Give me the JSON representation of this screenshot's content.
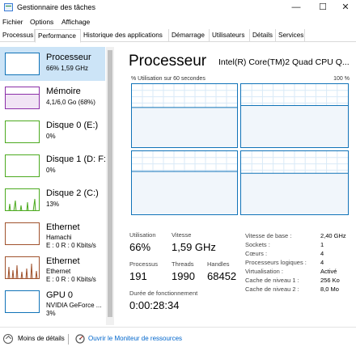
{
  "window": {
    "title": "Gestionnaire des tâches",
    "minimize_glyph": "—",
    "maximize_glyph": "☐",
    "close_glyph": "✕"
  },
  "menu": [
    "Fichier",
    "Options",
    "Affichage"
  ],
  "tabs": [
    {
      "label": "Processus",
      "active": false
    },
    {
      "label": "Performance",
      "active": true
    },
    {
      "label": "Historique des applications",
      "active": false
    },
    {
      "label": "Démarrage",
      "active": false
    },
    {
      "label": "Utilisateurs",
      "active": false
    },
    {
      "label": "Détails",
      "active": false
    },
    {
      "label": "Services",
      "active": false
    }
  ],
  "sidebar": [
    {
      "name": "Processeur",
      "lines": [
        "66% 1,59 GHz"
      ],
      "color": "#1173b8",
      "selected": true,
      "icon": "cpu-thumbnail-icon"
    },
    {
      "name": "Mémoire",
      "lines": [
        "4,1/6,0 Go (68%)"
      ],
      "color": "#8b2fa8",
      "selected": false,
      "icon": "memory-thumbnail-icon",
      "fill": 0.68
    },
    {
      "name": "Disque 0 (E:)",
      "lines": [
        "0%"
      ],
      "color": "#4caa1f",
      "selected": false,
      "icon": "disk-thumbnail-icon"
    },
    {
      "name": "Disque 1 (D: F:)",
      "lines": [
        "0%"
      ],
      "color": "#4caa1f",
      "selected": false,
      "icon": "disk-thumbnail-icon"
    },
    {
      "name": "Disque 2 (C:)",
      "lines": [
        "13%"
      ],
      "color": "#4caa1f",
      "selected": false,
      "icon": "disk-thumbnail-icon"
    },
    {
      "name": "Ethernet",
      "lines": [
        "Hamachi",
        "E : 0 R : 0 Kbits/s"
      ],
      "color": "#a0522d",
      "selected": false,
      "icon": "network-thumbnail-icon"
    },
    {
      "name": "Ethernet",
      "lines": [
        "Ethernet",
        "E : 0 R : 0 Kbits/s"
      ],
      "color": "#a0522d",
      "selected": false,
      "icon": "network-thumbnail-icon"
    },
    {
      "name": "GPU 0",
      "lines": [
        "NVIDIA GeForce ...",
        "3%"
      ],
      "color": "#1173b8",
      "selected": false,
      "icon": "gpu-thumbnail-icon"
    }
  ],
  "main": {
    "title": "Processeur",
    "cpu_model": "Intel(R) Core(TM)2 Quad CPU Q...",
    "graph_caption": "% Utilisation sur 60 secondes",
    "graph_max": "100 %",
    "graph_color": "#1173b8",
    "cores_usage_percent": [
      63,
      66,
      68,
      65
    ]
  },
  "stats": {
    "utilisation_label": "Utilisation",
    "utilisation_value": "66%",
    "vitesse_label": "Vitesse",
    "vitesse_value": "1,59 GHz",
    "processus_label": "Processus",
    "processus_value": "191",
    "threads_label": "Threads",
    "threads_value": "1990",
    "handles_label": "Handles",
    "handles_value": "68452",
    "uptime_label": "Durée de fonctionnement",
    "uptime_value": "0:00:28:34"
  },
  "specs": [
    {
      "label": "Vitesse de base :",
      "value": "2,40 GHz"
    },
    {
      "label": "Sockets :",
      "value": "1"
    },
    {
      "label": "Cœurs :",
      "value": "4"
    },
    {
      "label": "Processeurs logiques :",
      "value": "4"
    },
    {
      "label": "Virtualisation :",
      "value": "Activé"
    },
    {
      "label": "Cache de niveau 1 :",
      "value": "256 Ko"
    },
    {
      "label": "Cache de niveau 2 :",
      "value": "8,0 Mo"
    }
  ],
  "footer": {
    "less_details": "Moins de détails",
    "resource_monitor": "Ouvrir le Moniteur de ressources"
  }
}
